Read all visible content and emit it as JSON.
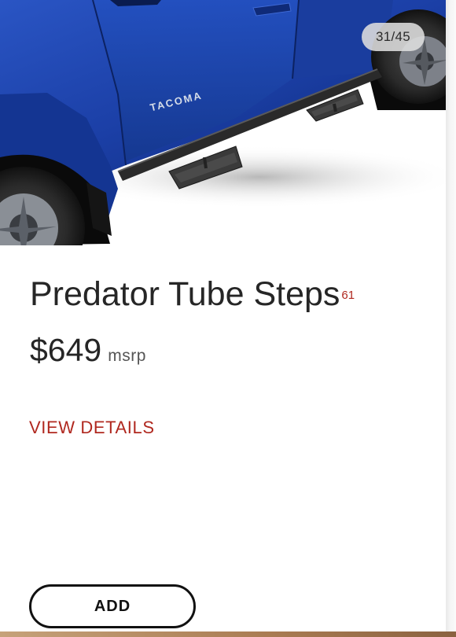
{
  "gallery": {
    "counter": "31/45",
    "image_badge_text": "TACOMA",
    "vehicle_color": "#1b3fa6"
  },
  "product": {
    "title": "Predator Tube Steps",
    "footnote": "61",
    "price": "$649",
    "price_suffix": "msrp",
    "details_link": "VIEW DETAILS",
    "add_button": "ADD"
  },
  "colors": {
    "accent_red": "#b0281f",
    "text_dark": "#262626"
  }
}
